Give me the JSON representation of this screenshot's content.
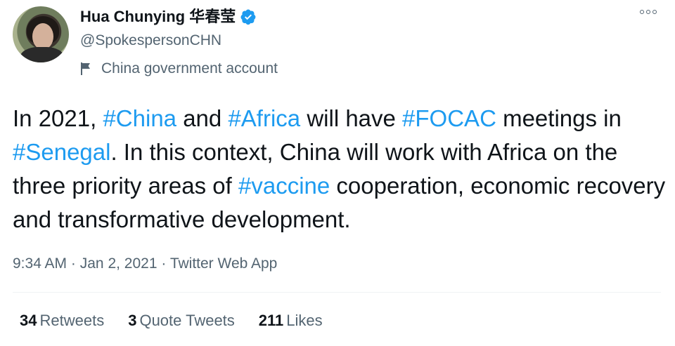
{
  "author": {
    "name": "Hua Chunying 华春莹",
    "handle": "@SpokespersonCHN",
    "label": "China government account"
  },
  "tweet": {
    "segments": [
      {
        "text": "In 2021, ",
        "hashtag": false
      },
      {
        "text": "#China",
        "hashtag": true
      },
      {
        "text": " and ",
        "hashtag": false
      },
      {
        "text": "#Africa",
        "hashtag": true
      },
      {
        "text": " will have ",
        "hashtag": false
      },
      {
        "text": "#FOCAC",
        "hashtag": true
      },
      {
        "text": " meetings in ",
        "hashtag": false
      },
      {
        "text": "#Senegal",
        "hashtag": true
      },
      {
        "text": ". In this context, China will work with Africa on the three priority areas of ",
        "hashtag": false
      },
      {
        "text": "#vaccine",
        "hashtag": true
      },
      {
        "text": " cooperation, economic recovery and transformative development.",
        "hashtag": false
      }
    ]
  },
  "meta": {
    "time": "9:34 AM",
    "separator": "·",
    "date": "Jan 2, 2021",
    "source": "Twitter Web App"
  },
  "stats": {
    "retweets_count": "34",
    "retweets_label": "Retweets",
    "quotes_count": "3",
    "quotes_label": "Quote Tweets",
    "likes_count": "211",
    "likes_label": "Likes"
  },
  "colors": {
    "accent": "#1d9bf0",
    "secondary_text": "#536471",
    "primary_text": "#0f1419"
  },
  "icons": [
    "verified-badge-icon",
    "flag-icon",
    "more-options-icon"
  ]
}
